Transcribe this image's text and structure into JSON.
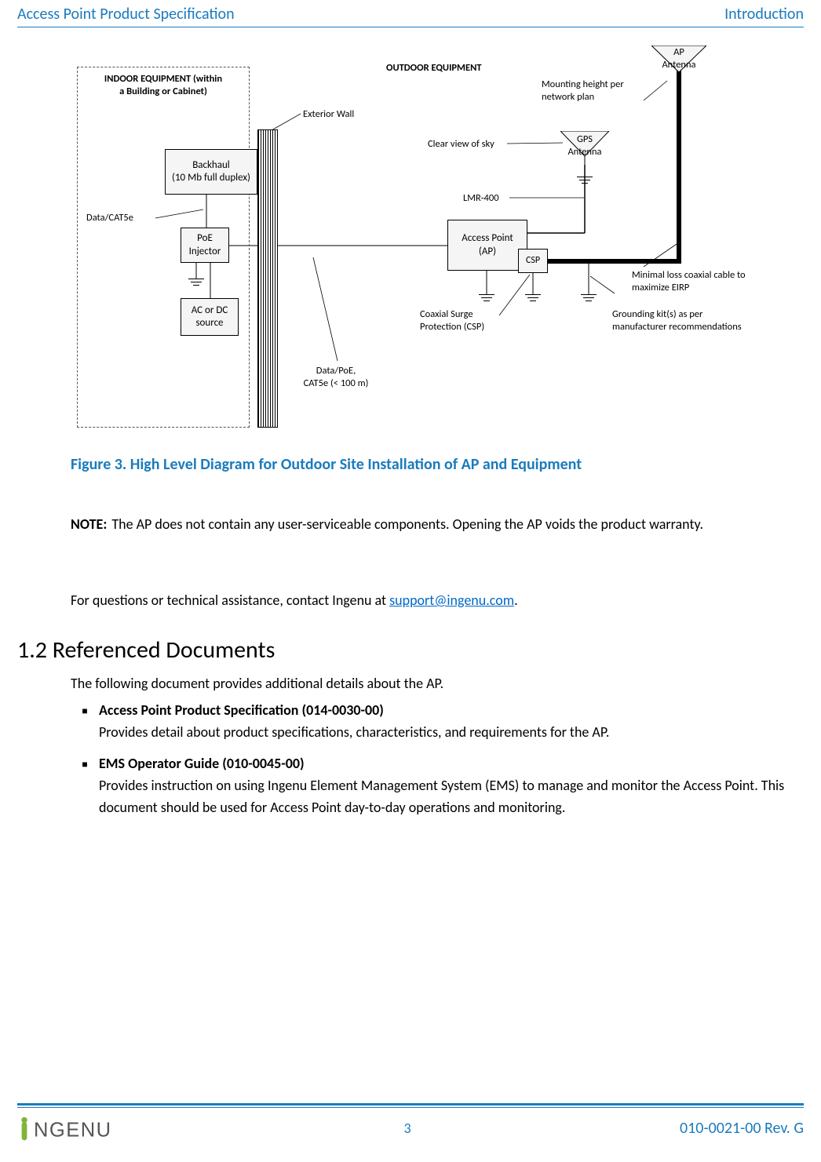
{
  "header": {
    "left": "Access Point Product Specification",
    "right": "Introduction"
  },
  "diagram": {
    "outdoor_title": "OUTDOOR EQUIPMENT",
    "indoor_title": "INDOOR EQUIPMENT (within\na Building or Cabinet)",
    "backhaul": "Backhaul\n(10 Mb full duplex)",
    "poe": "PoE\nInjector",
    "source": "AC or DC\nsource",
    "ap": "Access Point\n(AP)",
    "csp": "CSP",
    "gps": "GPS\nAntenna",
    "ap_ant": "AP\nAntenna",
    "data_cat5e": "Data/CAT5e",
    "ext_wall": "Exterior Wall",
    "clear_sky": "Clear view of sky",
    "lmr400": "LMR-400",
    "mount_h": "Mounting height per\nnetwork plan",
    "min_loss": "Minimal loss coaxial cable to\nmaximize EIRP",
    "ground_kit": "Grounding kit(s) as per\nmanufacturer recommendations",
    "csp_full": "Coaxial Surge\nProtection (CSP)",
    "data_poe": "Data/PoE,\nCAT5e (< 100 m)"
  },
  "figure_caption": "Figure 3. High Level Diagram for Outdoor Site Installation of AP and Equipment",
  "note": {
    "label": "NOTE:",
    "body": "The AP does not contain any user-serviceable components. Opening the AP voids the product warranty."
  },
  "support": {
    "pre": "For questions or technical assistance, contact Ingenu at ",
    "email": "support@ingenu.com",
    "post": "."
  },
  "section12": {
    "heading": "1.2  Referenced Documents",
    "intro": "The following document provides additional details about the AP.",
    "bullets": [
      {
        "title": "Access Point Product Specification (014-0030-00)",
        "body": "Provides detail about product specifications, characteristics, and requirements for the AP."
      },
      {
        "title": "EMS Operator Guide (010-0045-00)",
        "body": "Provides instruction on using Ingenu Element Management System (EMS)  to manage and monitor the Access Point.  This document should be used for Access Point day-to-day operations and monitoring."
      }
    ]
  },
  "footer": {
    "page_num": "3",
    "doc_rev": "010-0021-00 Rev. G",
    "logo_text": "iNGENU"
  }
}
